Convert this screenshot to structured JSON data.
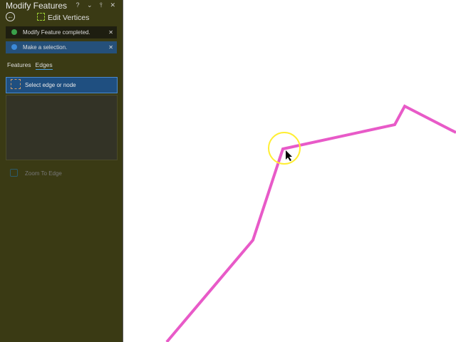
{
  "panel": {
    "title": "Modify Features",
    "controls": "? ⌄ ⫯ ✕",
    "tool": "Edit Vertices",
    "messages": [
      {
        "text": "Modify Feature completed.",
        "color": "#3aa04a",
        "bg": "#1e1e10"
      },
      {
        "text": "Make a selection.",
        "color": "#3c8ad8",
        "bg": "#25507a"
      }
    ],
    "tabs": [
      "Features",
      "Edges"
    ],
    "select_button": "Select edge or node",
    "zoom_to_edge": "Zoom To Edge"
  },
  "map": {
    "line_color": "#e85ac8",
    "highlight_color": "#ffee33"
  }
}
